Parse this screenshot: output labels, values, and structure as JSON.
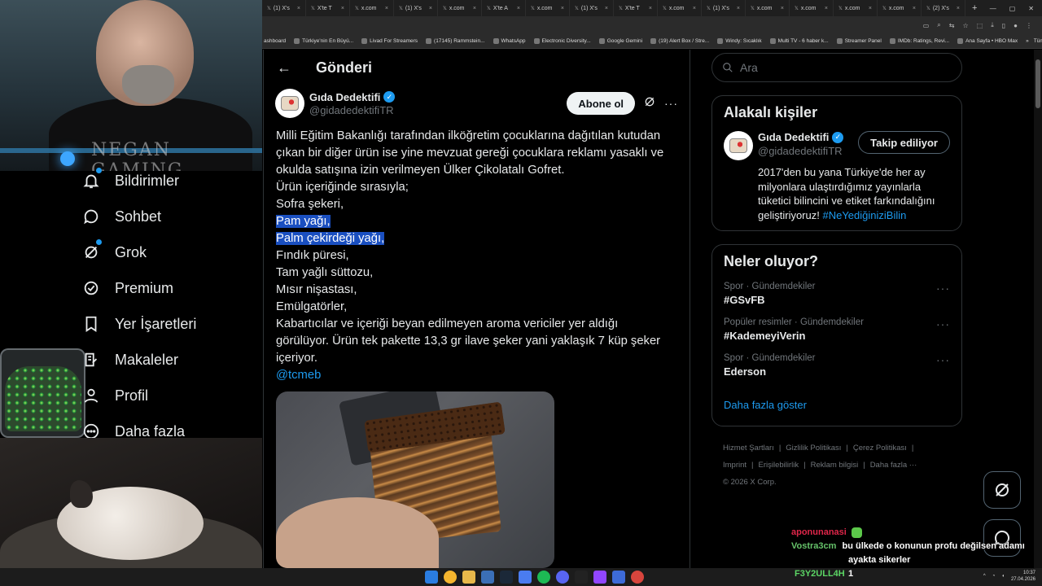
{
  "tabs": [
    {
      "label": "(1) X's"
    },
    {
      "label": "X'te T"
    },
    {
      "label": "x.com"
    },
    {
      "label": "(1) X's"
    },
    {
      "label": "x.com"
    },
    {
      "label": "X'te A"
    },
    {
      "label": "x.com"
    },
    {
      "label": "(1) X's"
    },
    {
      "label": "X'te T"
    },
    {
      "label": "x.com"
    },
    {
      "label": "(1) X's"
    },
    {
      "label": "x.com"
    },
    {
      "label": "x.com"
    },
    {
      "label": "x.com"
    },
    {
      "label": "x.com"
    },
    {
      "label": "(2) X's"
    }
  ],
  "bookmarks": [
    "ashboard",
    "Türkiye'nin En Büyü...",
    "Livad For Streamers",
    "(17145) Rammstein...",
    "WhatsApp",
    "Electronic Diversity...",
    "Google Gemini",
    "(19) Alert Box / Stre...",
    "Windy: Sıcaklık",
    "Multi TV - 6 haber k...",
    "Streamer Panel",
    "IMDb: Ratings, Revi...",
    "Ana Sayfa • HBO Max"
  ],
  "bookmarks_all": "Tüm Yer İşaretleri",
  "webcam_logo": "NEGAN GAMING",
  "nav": {
    "notifications": "Bildirimler",
    "chat": "Sohbet",
    "grok": "Grok",
    "premium": "Premium",
    "bookmarks": "Yer İşaretleri",
    "articles": "Makaleler",
    "profile": "Profil",
    "more": "Daha fazla"
  },
  "main": {
    "title": "Gönderi",
    "author_name": "Gıda Dedektifi",
    "author_handle": "@gidadedektifiTR",
    "follow_label": "Abone ol",
    "lines": [
      "Milli Eğitim Bakanlığı tarafından ilköğretim çocuklarına dağıtılan kutudan",
      "çıkan bir diğer ürün ise yine mevzuat gereği çocuklara reklamı yasaklı ve",
      "okulda satışına izin verilmeyen Ülker Çikolatalı Gofret.",
      "Ürün içeriğinde sırasıyla;",
      "Sofra şekeri,"
    ],
    "highlight_lines": [
      "Pam yağı,",
      "Palm çekirdeği yağı,"
    ],
    "lines2": [
      "Fındık püresi,",
      "Tam yağlı süttozu,",
      "Mısır nişastası,",
      "Emülgatörler,",
      "Kabartıcılar ve içeriği beyan edilmeyen aroma vericiler yer aldığı",
      "görülüyor. Ürün tek pakette 13,3 gr ilave şeker yani yaklaşık 7 küp şeker",
      "içeriyor."
    ],
    "mention": "@tcmeb"
  },
  "search": {
    "placeholder": "Ara"
  },
  "related": {
    "title": "Alakalı kişiler",
    "name": "Gıda Dedektifi",
    "handle": "@gidadedektifiTR",
    "following_label": "Takip ediliyor",
    "bio_lines": [
      "2017'den bu yana Türkiye'de her ay",
      "milyonlara ulaştırdığımız yayınlarla",
      "tüketici bilincini ve etiket farkındalığını",
      "geliştiriyoruz!"
    ],
    "bio_tag": "#NeYediğiniziBilin"
  },
  "trends": {
    "title": "Neler oluyor?",
    "items": [
      {
        "meta": "Spor · Gündemdekiler",
        "name": "#GSvFB"
      },
      {
        "meta": "Popüler resimler · Gündemdekiler",
        "name": "#KademeyiVerin"
      },
      {
        "meta": "Spor · Gündemdekiler",
        "name": "Ederson"
      }
    ],
    "show_more": "Daha fazla göster"
  },
  "footer": {
    "row1": [
      "Hizmet Şartları",
      "|",
      "Gizlilik Politikası",
      "|",
      "Çerez Politikası",
      "|"
    ],
    "row2": [
      "Imprint",
      "|",
      "Erişilebilirlik",
      "|",
      "Reklam bilgisi",
      "|",
      "Daha fazla ···"
    ],
    "copyright": "© 2026 X Corp."
  },
  "chat": {
    "user1": "aponunanasi",
    "user2": "Vostra3cm",
    "msg2": "bu ülkede o konunun profu değilsen adamı",
    "msg2_cont": "ayakta sikerler"
  },
  "taskbar": {
    "user": "F3Y2ULL4H",
    "count": "1",
    "time": "10:37",
    "date": "27.04.2026"
  },
  "colors": {
    "accent": "#1d9bf0",
    "highlight": "#1a4fc0",
    "background": "#000000",
    "border": "#2f3336"
  }
}
